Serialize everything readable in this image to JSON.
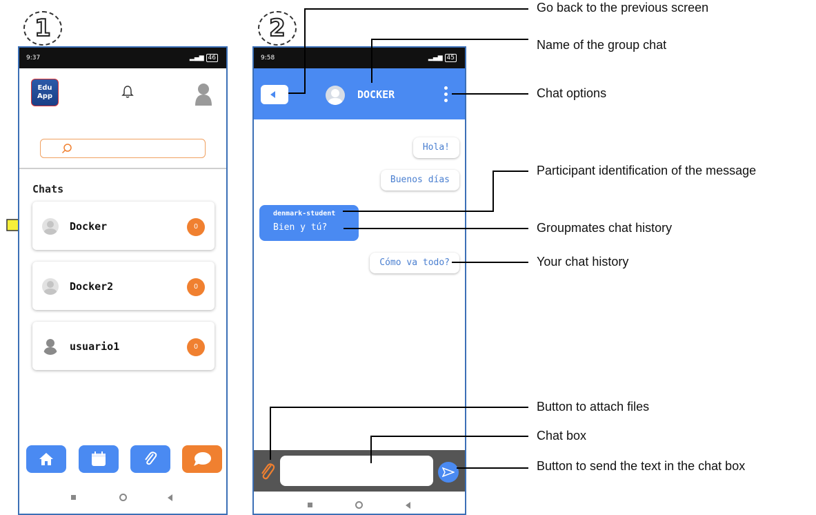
{
  "steps": {
    "first": "1",
    "second": "2"
  },
  "screen1": {
    "status_time": "9:37",
    "status_right": "46",
    "logo_text": "Edu App",
    "search": {
      "placeholder": ""
    },
    "chats_title": "Chats",
    "chats": [
      {
        "name": "Docker",
        "unread": "0"
      },
      {
        "name": "Docker2",
        "unread": "0"
      },
      {
        "name": "usuario1",
        "unread": "0"
      }
    ],
    "nav_icons": [
      "home-icon",
      "calendar-icon",
      "paperclip-icon",
      "chat-bubble-icon"
    ],
    "colors": {
      "accent_blue": "#4a8af2",
      "accent_orange": "#f08030",
      "highlight_arrow": "#f6f03a"
    }
  },
  "screen2": {
    "status_time": "9:58",
    "status_right": "45",
    "group_name": "DOCKER",
    "messages": [
      {
        "direction": "out",
        "text": "Hola!"
      },
      {
        "direction": "out",
        "text": "Buenos días"
      },
      {
        "direction": "in",
        "sender": "denmark-student",
        "text": "Bien y tú?"
      },
      {
        "direction": "out",
        "text": "Cómo va todo?"
      }
    ],
    "chatbox": {
      "placeholder": ""
    }
  },
  "annotations": {
    "back": "Go back to the previous screen",
    "group_name": "Name of the group chat",
    "options": "Chat options",
    "participant": "Participant identification of the message",
    "groupmates": "Groupmates chat history",
    "yours": "Your chat history",
    "attach": "Button to attach files",
    "chatbox": "Chat box",
    "send": "Button to send the text in the chat box"
  }
}
